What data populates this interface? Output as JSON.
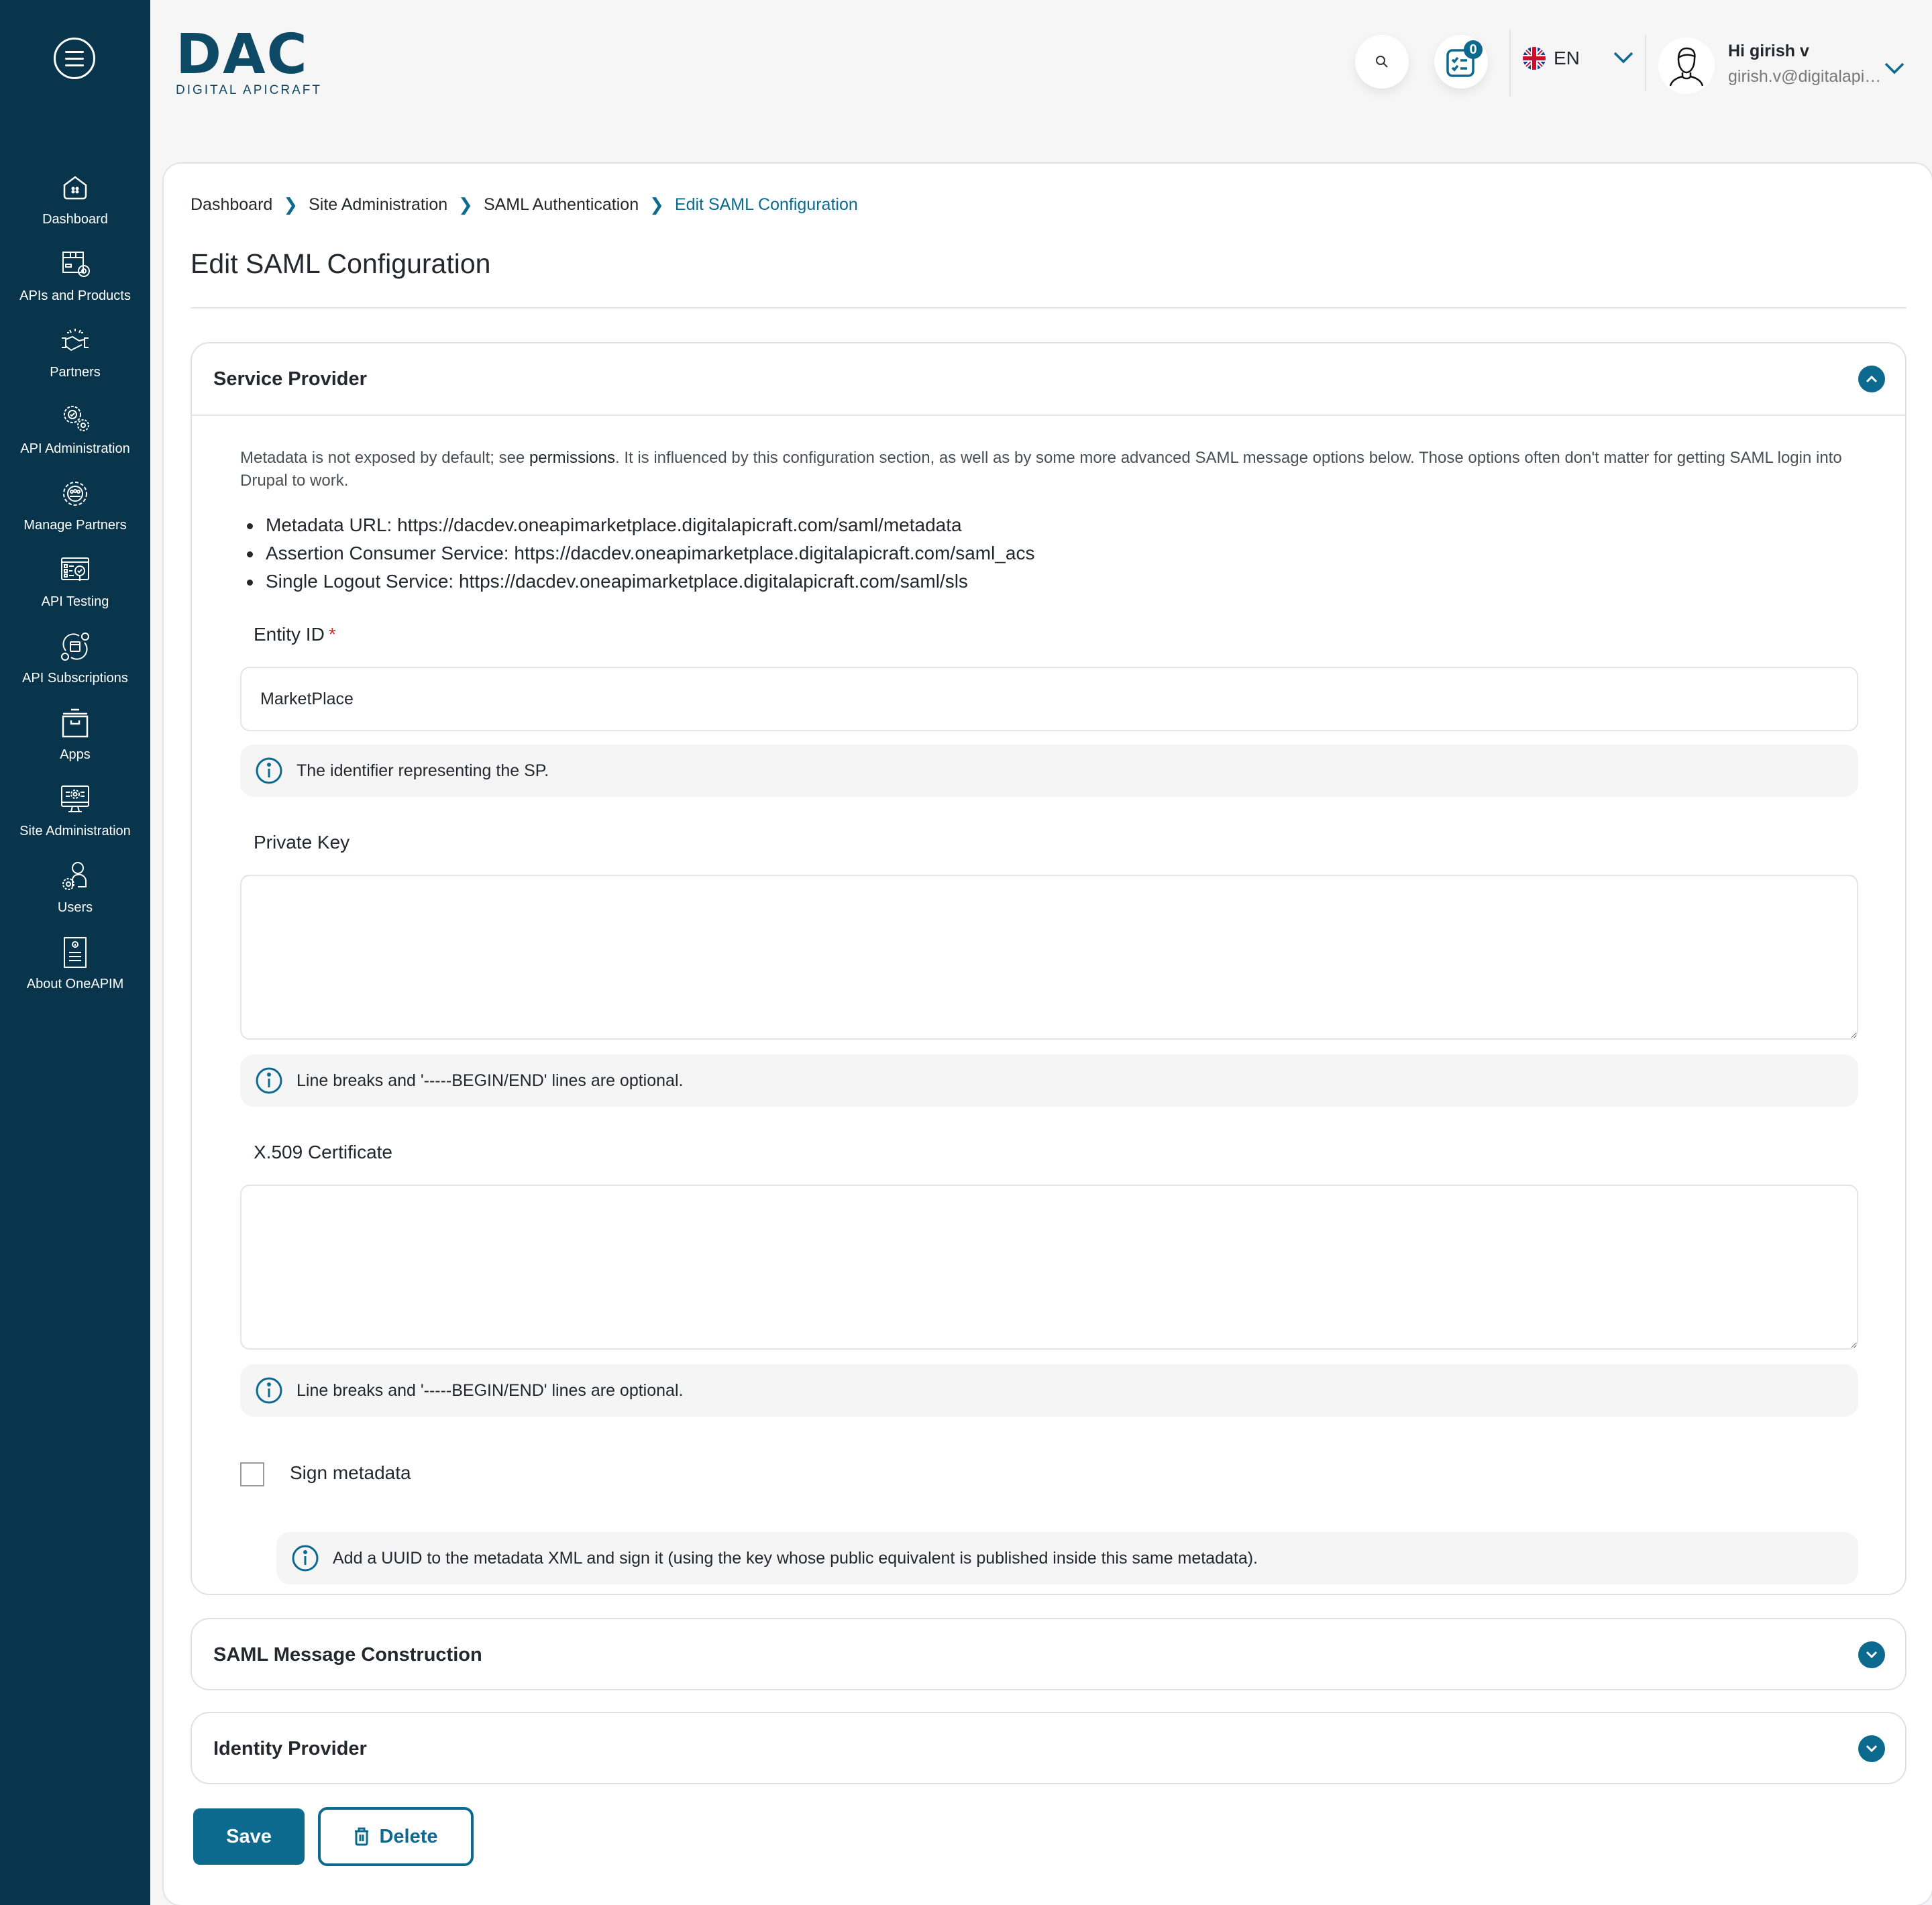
{
  "sidebar": {
    "menu_icon": "hamburger-menu-icon",
    "items": [
      {
        "label": "Dashboard",
        "icon": "home-icon"
      },
      {
        "label": "APIs and Products",
        "icon": "package-gear-icon"
      },
      {
        "label": "Partners",
        "icon": "handshake-icon"
      },
      {
        "label": "API Administration",
        "icon": "gears-icon"
      },
      {
        "label": "Manage Partners",
        "icon": "team-gear-icon"
      },
      {
        "label": "API Testing",
        "icon": "browser-check-icon"
      },
      {
        "label": "API Subscriptions",
        "icon": "subscription-cycle-icon"
      },
      {
        "label": "Apps",
        "icon": "archive-box-icon"
      },
      {
        "label": "Site Administration",
        "icon": "monitor-gear-icon"
      },
      {
        "label": "Users",
        "icon": "user-gear-icon"
      },
      {
        "label": "About OneAPIM",
        "icon": "info-document-icon"
      }
    ]
  },
  "header": {
    "logo_main": "DAC",
    "logo_sub": "DIGITAL APICRAFT",
    "task_badge_count": "0",
    "language": "EN",
    "user_greeting": "Hi girish v",
    "user_email": "girish.v@digitalapicraft.com"
  },
  "breadcrumb": [
    "Dashboard",
    "Site Administration",
    "SAML Authentication",
    "Edit SAML Configuration"
  ],
  "page_title": "Edit SAML Configuration",
  "service_provider": {
    "title": "Service Provider",
    "expanded": true,
    "description_before_link": "Metadata is not exposed by default; see ",
    "description_link": "permissions",
    "description_after_link": ". It is influenced by this configuration section, as well as by some more advanced SAML message options below. Those options often don't matter for getting SAML login into Drupal to work.",
    "urls": [
      "Metadata URL: https://dacdev.oneapimarketplace.digitalapicraft.com/saml/metadata",
      "Assertion Consumer Service: https://dacdev.oneapimarketplace.digitalapicraft.com/saml_acs",
      "Single Logout Service: https://dacdev.oneapimarketplace.digitalapicraft.com/saml/sls"
    ],
    "entity_id": {
      "label": "Entity ID",
      "required_mark": "*",
      "value": "MarketPlace",
      "help": "The identifier representing the SP."
    },
    "private_key": {
      "label": "Private Key",
      "value": "",
      "help": "Line breaks and '-----BEGIN/END' lines are optional."
    },
    "certificate": {
      "label": "X.509 Certificate",
      "value": "",
      "help": "Line breaks and '-----BEGIN/END' lines are optional."
    },
    "sign_metadata": {
      "label": "Sign metadata",
      "checked": false,
      "help": "Add a UUID to the metadata XML and sign it (using the key whose public equivalent is published inside this same metadata)."
    }
  },
  "saml_message_construction": {
    "title": "SAML Message Construction",
    "expanded": false
  },
  "identity_provider": {
    "title": "Identity Provider",
    "expanded": false
  },
  "actions": {
    "save_label": "Save",
    "delete_label": "Delete"
  },
  "colors": {
    "primary": "#0b6a8e",
    "sidebar": "#08354c",
    "required": "#d0312d"
  }
}
